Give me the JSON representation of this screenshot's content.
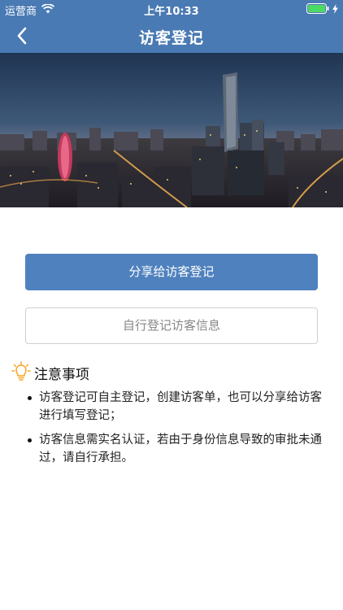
{
  "status_bar": {
    "carrier": "运营商",
    "time": "上午10:33"
  },
  "nav": {
    "title": "访客登记"
  },
  "actions": {
    "share_label": "分享给访客登记",
    "self_register_label": "自行登记访客信息"
  },
  "notice": {
    "title": "注意事项",
    "items": [
      "访客登记可自主登记，创建访客单，也可以分享给访客进行填写登记；",
      "访客信息需实名认证，若由于身份信息导致的审批未通过，请自行承担。"
    ]
  },
  "colors": {
    "accent": "#4a7ab3",
    "primary_button": "#4f81be",
    "notice_icon": "#f5a623"
  },
  "icons": {
    "back": "chevron-left-icon",
    "wifi": "wifi-icon",
    "battery": "battery-icon",
    "charging": "bolt-icon",
    "notice": "lightbulb-icon"
  }
}
